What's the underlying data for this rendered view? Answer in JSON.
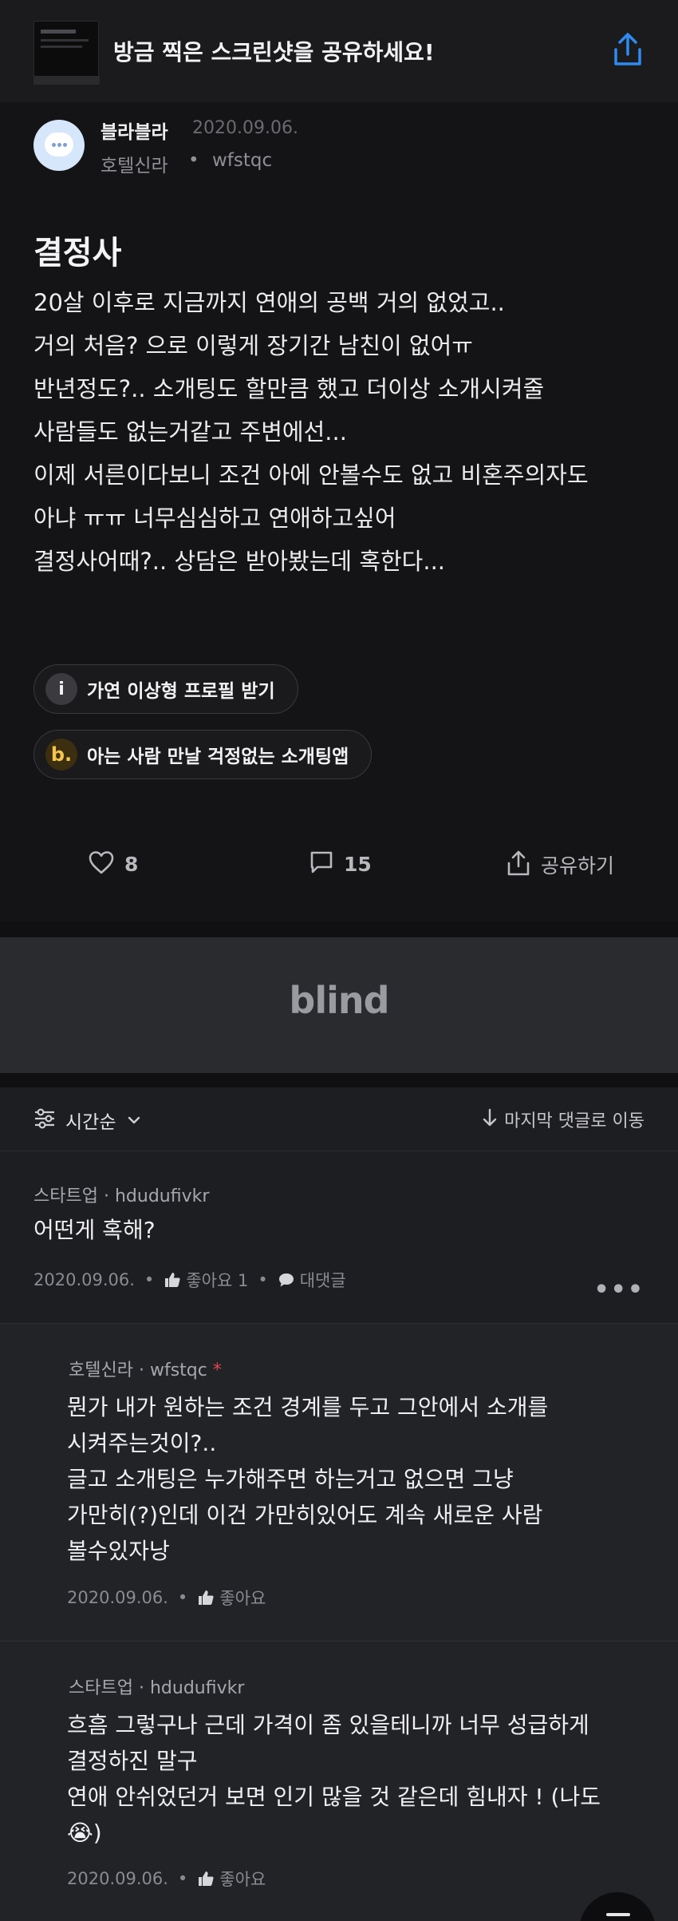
{
  "share_bar": {
    "title": "방금 찍은 스크린샷을 공유하세요!",
    "share_icon": "share-icon",
    "accent_color": "#2e8bf2"
  },
  "post": {
    "author": "블라블라",
    "date": "2020.09.06.",
    "company": "호텔신라",
    "meta_separator": "•",
    "user_id": "wfstqc",
    "title": "결정사",
    "lines": [
      "20살 이후로 지금까지 연애의 공백 거의 없었고..",
      "거의 처음? 으로 이렇게 장기간 남친이 없어ㅠ",
      "반년정도?.. 소개팅도 할만큼 했고 더이상 소개시켜줄",
      "사람들도 없는거같고 주변에선...",
      "이제 서른이다보니 조건 아에 안볼수도 없고 비혼주의자도",
      "아냐 ㅠㅠ 너무심심하고 연애하고싶어",
      "결정사어때?.. 상담은 받아봤는데 혹한다..."
    ]
  },
  "ads": [
    {
      "icon_glyph": "i",
      "label": "가연 이상형 프로필 받기"
    },
    {
      "icon_glyph": "b.",
      "label": "아는 사람 만날 걱정없는 소개팅앱"
    }
  ],
  "actions": {
    "likes": "8",
    "comments": "15",
    "share_label": "공유하기"
  },
  "banner": {
    "logo_text": "blind"
  },
  "sort_bar": {
    "sort_label": "시간순",
    "jump_label": "마지막 댓글로 이동"
  },
  "comments": [
    {
      "company": "스타트업",
      "sep": "·",
      "user_id": "hdudufivkr",
      "lines": [
        "어떤게 혹해?"
      ],
      "date": "2020.09.06.",
      "like_label": "좋아요 1",
      "reply_label": "대댓글",
      "more": "•••"
    }
  ],
  "replies": [
    {
      "company": "호텔신라",
      "sep": "·",
      "user_id": "wfstqc",
      "author_mark": "*",
      "lines": [
        "뭔가 내가 원하는 조건 경계를 두고 그안에서 소개를",
        "시켜주는것이?..",
        "글고 소개팅은 누가해주면 하는거고 없으면 그냥",
        "가만히(?)인데 이건 가만히있어도 계속 새로운 사람",
        "볼수있자낭"
      ],
      "date": "2020.09.06.",
      "like_label": "좋아요"
    },
    {
      "company": "스타트업",
      "sep": "·",
      "user_id": "hdudufivkr",
      "lines": [
        "흐흠 그렇구나 근데 가격이 좀 있을테니까 너무 성급하게",
        "결정하진 말구",
        "연애 안쉬었던거 보면 인기 많을 것 같은데 힘내자 ! (나도",
        "😭)"
      ],
      "date": "2020.09.06.",
      "like_label": "좋아요"
    }
  ]
}
